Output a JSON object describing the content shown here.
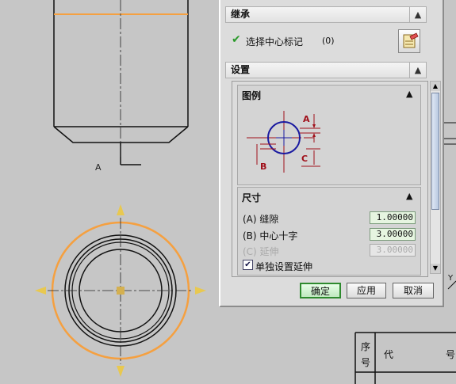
{
  "inherit_section": {
    "title": "继承",
    "select_center_label": "选择中心标记",
    "select_count": "(0)",
    "collapse_glyph": "▲"
  },
  "settings_section": {
    "title": "设置",
    "collapse_glyph": "▲"
  },
  "legend_section": {
    "title": "图例",
    "collapse_glyph": "▲",
    "labels": {
      "a": "A",
      "b": "B",
      "c": "C"
    }
  },
  "size_section": {
    "title": "尺寸",
    "collapse_glyph": "▲",
    "gap_label": "(A) 缝隙",
    "gap_value": "1.00000",
    "cross_label": "(B) 中心十字",
    "cross_value": "3.00000",
    "ext_label": "(C) 延伸",
    "ext_value": "3.00000",
    "separate_ext_label": "单独设置延伸",
    "separate_ext_checked": true
  },
  "buttons": {
    "ok": "确定",
    "apply": "应用",
    "cancel": "取消"
  },
  "drawing": {
    "view_label": "A",
    "title_block": {
      "seq": "序号",
      "code": "代",
      "num": "号"
    },
    "right_text": "Y"
  },
  "colors": {
    "orange": "#f5a040",
    "ok_green": "#2a9a2a",
    "legend_red": "#a0101a",
    "legend_blue": "#1a1aa0"
  }
}
